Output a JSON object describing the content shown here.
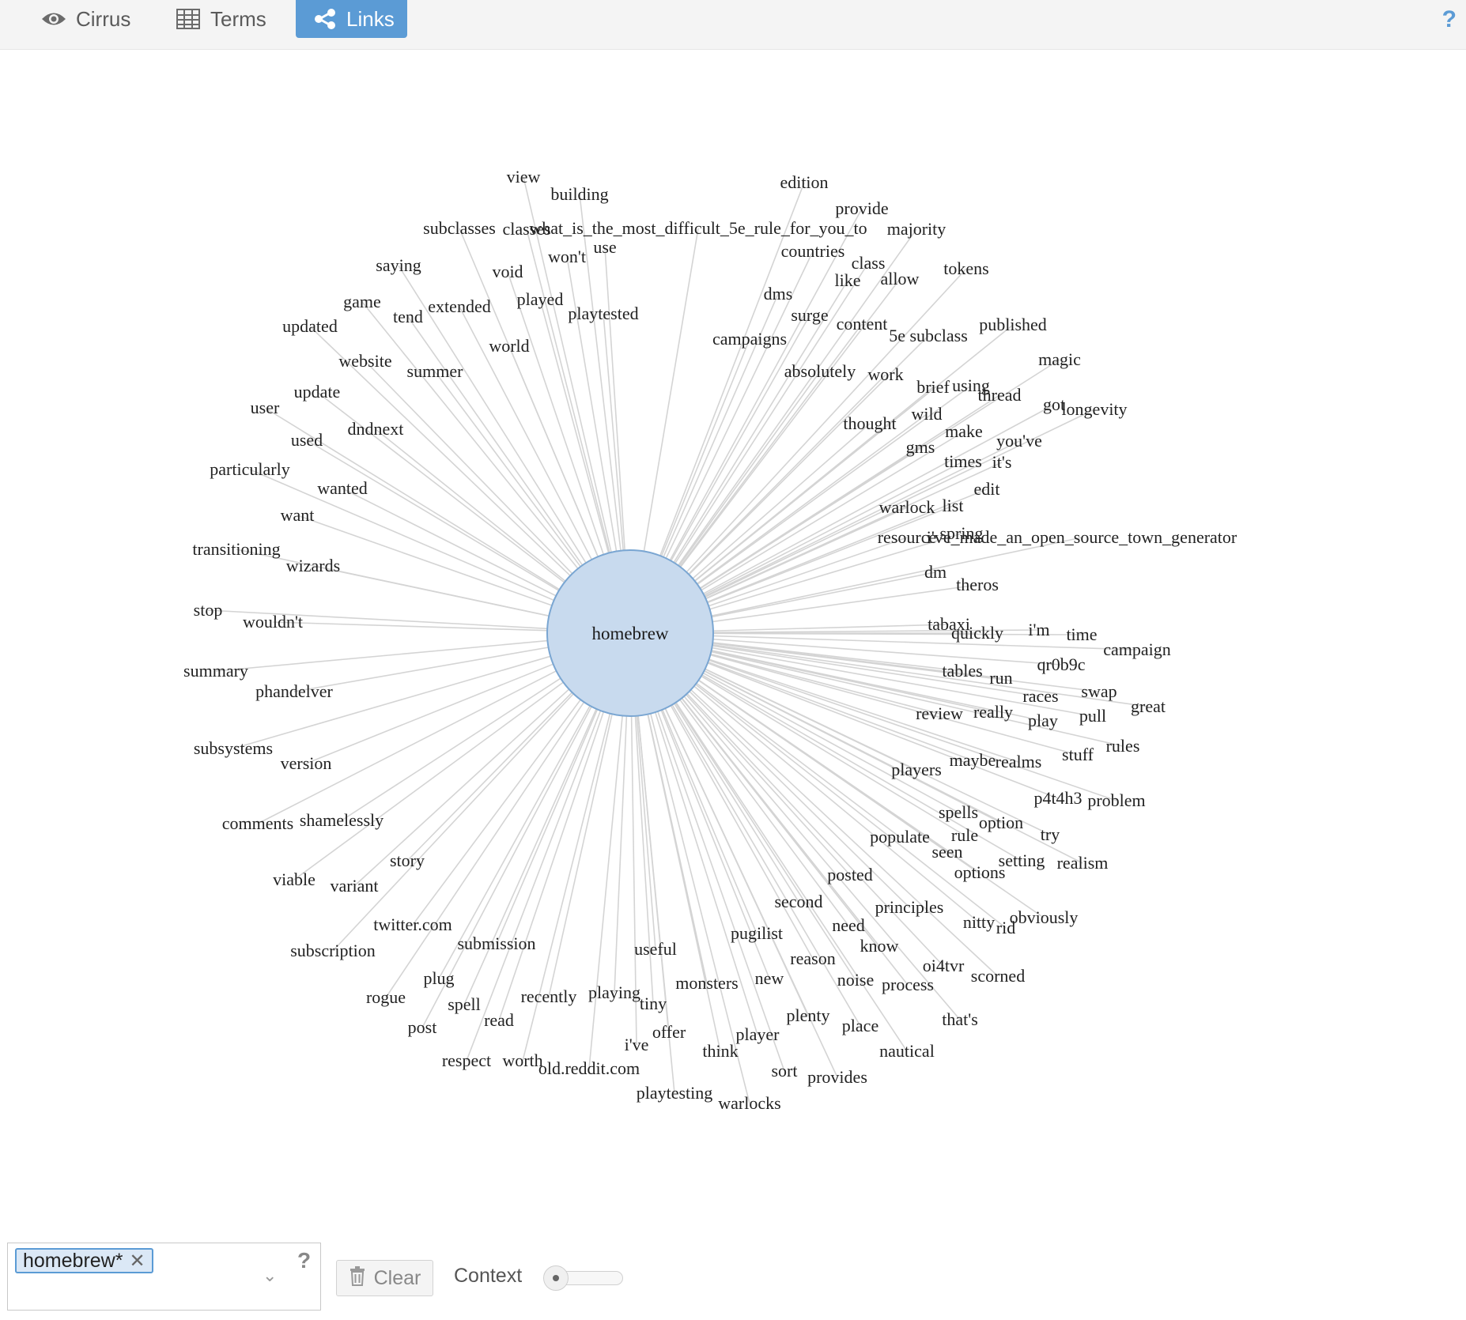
{
  "tabs": [
    {
      "label": "Cirrus",
      "icon": "eye-icon",
      "active": false
    },
    {
      "label": "Terms",
      "icon": "table-icon",
      "active": false
    },
    {
      "label": "Links",
      "icon": "share-icon",
      "active": true
    }
  ],
  "help_label": "?",
  "colors": {
    "accent": "#5b9bd5",
    "node_fill": "#c8daee",
    "node_stroke": "#7aa6d2",
    "link": "#d4d4d4"
  },
  "graph": {
    "center": "homebrew",
    "terms": [
      "view",
      "building",
      "edition",
      "provide",
      "subclasses",
      "classes",
      "what_is_the_most_difficult_5e_rule_for_you_to",
      "majority",
      "use",
      "won't",
      "countries",
      "class",
      "saying",
      "void",
      "like",
      "allow",
      "tokens",
      "played",
      "dms",
      "game",
      "extended",
      "tend",
      "playtested",
      "surge",
      "content",
      "updated",
      "campaigns",
      "published",
      "5e subclass",
      "world",
      "magic",
      "website",
      "summer",
      "absolutely",
      "work",
      "brief",
      "using",
      "thread",
      "update",
      "got",
      "longevity",
      "user",
      "dndnext",
      "wild",
      "thought",
      "used",
      "make",
      "you've",
      "gms",
      "times",
      "it's",
      "particularly",
      "wanted",
      "edit",
      "warlock",
      "list",
      "want",
      "spring",
      "resource",
      "i've_made_an_open_source_town_generator",
      "transitioning",
      "wizards",
      "dm",
      "theros",
      "stop",
      "wouldn't",
      "tabaxi",
      "quickly",
      "i'm",
      "time",
      "campaign",
      "summary",
      "tables",
      "run",
      "qr0b9c",
      "phandelver",
      "swap",
      "races",
      "really",
      "review",
      "pull",
      "great",
      "play",
      "subsystems",
      "version",
      "rules",
      "stuff",
      "players",
      "maybe",
      "realms",
      "p4t4h3",
      "problem",
      "comments",
      "shamelessly",
      "spells",
      "option",
      "try",
      "populate",
      "rule",
      "seen",
      "story",
      "setting",
      "realism",
      "viable",
      "variant",
      "options",
      "posted",
      "second",
      "principles",
      "twitter.com",
      "need",
      "nitty",
      "rid",
      "obviously",
      "pugilist",
      "subscription",
      "submission",
      "useful",
      "know",
      "reason",
      "oi4tvr",
      "plug",
      "new",
      "noise",
      "process",
      "scorned",
      "monsters",
      "rogue",
      "recently",
      "playing",
      "tiny",
      "spell",
      "plenty",
      "read",
      "that's",
      "post",
      "offer",
      "place",
      "player",
      "i've",
      "think",
      "nautical",
      "respect",
      "worth",
      "old.reddit.com",
      "sort",
      "provides",
      "playtesting",
      "warlocks"
    ]
  },
  "bottom": {
    "term_chip": "homebrew*",
    "help": "?",
    "clear_label": "Clear",
    "context_label": "Context",
    "context_level": 0.1
  }
}
